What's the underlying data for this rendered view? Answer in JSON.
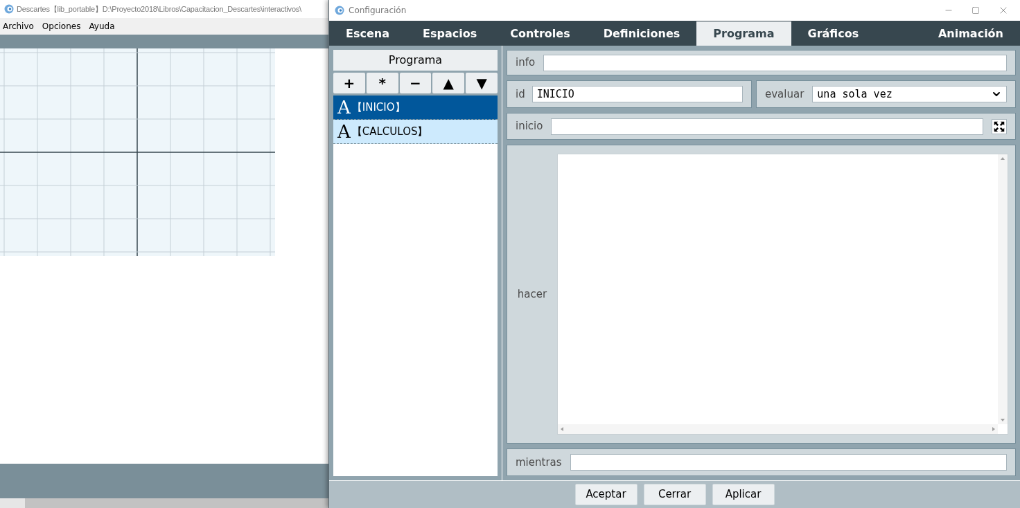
{
  "back_window": {
    "title": "Descartes【lib_portable】D:\\Proyecto2018\\Libros\\Capacitacion_Descartes\\interactivos\\",
    "menu": [
      "Archivo",
      "Opciones",
      "Ayuda"
    ]
  },
  "dialog": {
    "title": "Configuración",
    "tabs": [
      {
        "label": "Escena",
        "selected": false
      },
      {
        "label": "Espacios",
        "selected": false
      },
      {
        "label": "Controles",
        "selected": false
      },
      {
        "label": "Definiciones",
        "selected": false
      },
      {
        "label": "Programa",
        "selected": true
      },
      {
        "label": "Gráficos",
        "selected": false
      },
      {
        "label": "Animación",
        "selected": false
      }
    ],
    "program_panel": {
      "header": "Programa",
      "tool_buttons": [
        "+",
        "*",
        "−",
        "▲",
        "▼"
      ],
      "items": [
        {
          "glyph": "A",
          "label": "【INICIO】",
          "selected": true
        },
        {
          "glyph": "A",
          "label": "【CALCULOS】",
          "selected": false
        }
      ]
    },
    "info": {
      "label": "info"
    },
    "id": {
      "label": "id",
      "value": "INICIO"
    },
    "evaluar": {
      "label": "evaluar",
      "value": "una sola vez"
    },
    "inicio": {
      "label": "inicio"
    },
    "hacer": {
      "label": "hacer"
    },
    "mientras": {
      "label": "mientras"
    },
    "buttons": [
      "Aceptar",
      "Cerrar",
      "Aplicar"
    ]
  }
}
